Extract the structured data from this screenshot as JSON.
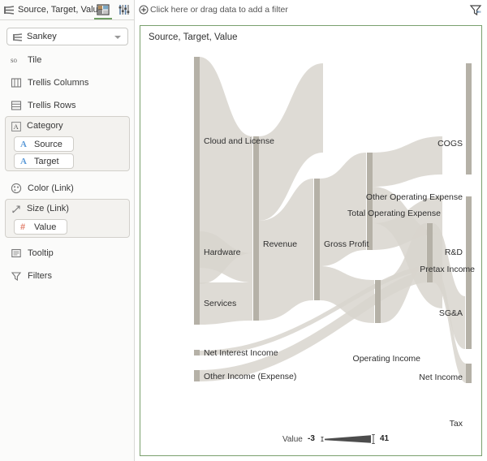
{
  "topbar": {
    "title": "Source, Target, Value",
    "sankey_icon": "sankey-icon",
    "button1_icon": "layout-panels-icon",
    "button2_icon": "sliders-icon"
  },
  "filterbar": {
    "plus_icon": "plus-circle-icon",
    "placeholder": "Click here or drag data to add a filter",
    "right_icon": "filter-funnel-icon"
  },
  "sidebar": {
    "visualization": {
      "label": "Sankey",
      "icon": "sankey-icon",
      "caret": "chevron-down-icon"
    },
    "shelves": [
      {
        "label": "Tile",
        "icon": "tile-icon"
      },
      {
        "label": "Trellis Columns",
        "icon": "trellis-columns-icon"
      },
      {
        "label": "Trellis Rows",
        "icon": "trellis-rows-icon"
      }
    ],
    "category_group": {
      "label": "Category",
      "icon": "category-text-icon",
      "pills": [
        {
          "label": "Source",
          "glyph": "A",
          "kind": "cat"
        },
        {
          "label": "Target",
          "glyph": "A",
          "kind": "cat"
        }
      ]
    },
    "color_shelf": {
      "label": "Color (Link)",
      "icon": "color-palette-icon"
    },
    "size_group": {
      "label": "Size (Link)",
      "icon": "size-arrow-icon",
      "pills": [
        {
          "label": "Value",
          "glyph": "#",
          "kind": "num"
        }
      ]
    },
    "tooltip_shelf": {
      "label": "Tooltip",
      "icon": "tooltip-icon"
    },
    "filters_shelf": {
      "label": "Filters",
      "icon": "filter-funnel-icon"
    }
  },
  "chart": {
    "title": "Source, Target, Value",
    "legend": {
      "title": "Value",
      "min": "-3",
      "max": "41"
    }
  },
  "chart_data": {
    "type": "sankey",
    "title": "Source, Target, Value",
    "value_range": [
      -3,
      41
    ],
    "node_color": "#b5b1a7",
    "link_color": "#d8d5ce",
    "nodes": [
      {
        "id": "cloud_and_license",
        "label": "Cloud and License",
        "column": 0
      },
      {
        "id": "hardware",
        "label": "Hardware",
        "column": 0
      },
      {
        "id": "services",
        "label": "Services",
        "column": 0
      },
      {
        "id": "net_interest_income",
        "label": "Net Interest Income",
        "column": 0
      },
      {
        "id": "other_income_expense",
        "label": "Other Income (Expense)",
        "column": 0
      },
      {
        "id": "revenue",
        "label": "Revenue",
        "column": 1
      },
      {
        "id": "gross_profit",
        "label": "Gross Profit",
        "column": 2
      },
      {
        "id": "total_operating_expense",
        "label": "Total Operating Expense",
        "column": 3
      },
      {
        "id": "operating_income",
        "label": "Operating Income",
        "column": 4
      },
      {
        "id": "cogs",
        "label": "COGS",
        "column": 5
      },
      {
        "id": "other_operating_expense",
        "label": "Other Operating Expense",
        "column": 5
      },
      {
        "id": "rd",
        "label": "R&D",
        "column": 5
      },
      {
        "id": "pretax_income",
        "label": "Pretax Income",
        "column": 4
      },
      {
        "id": "sga",
        "label": "SG&A",
        "column": 5
      },
      {
        "id": "net_income",
        "label": "Net Income",
        "column": 5
      },
      {
        "id": "tax",
        "label": "Tax",
        "column": 5
      }
    ],
    "links": [
      {
        "source": "cloud_and_license",
        "target": "revenue",
        "value": 26
      },
      {
        "source": "hardware",
        "target": "revenue",
        "value": 6
      },
      {
        "source": "services",
        "target": "revenue",
        "value": 9
      },
      {
        "source": "revenue",
        "target": "gross_profit",
        "value": 27
      },
      {
        "source": "revenue",
        "target": "cogs",
        "value": 14
      },
      {
        "source": "gross_profit",
        "target": "total_operating_expense",
        "value": 19
      },
      {
        "source": "gross_profit",
        "target": "operating_income",
        "value": 8
      },
      {
        "source": "total_operating_expense",
        "target": "other_operating_expense",
        "value": 4
      },
      {
        "source": "total_operating_expense",
        "target": "rd",
        "value": 6
      },
      {
        "source": "total_operating_expense",
        "target": "sga",
        "value": 9
      },
      {
        "source": "operating_income",
        "target": "pretax_income",
        "value": 8
      },
      {
        "source": "net_interest_income",
        "target": "pretax_income",
        "value": 1
      },
      {
        "source": "other_income_expense",
        "target": "pretax_income",
        "value": 3
      },
      {
        "source": "pretax_income",
        "target": "net_income",
        "value": 9
      },
      {
        "source": "pretax_income",
        "target": "tax",
        "value": 2
      }
    ]
  }
}
